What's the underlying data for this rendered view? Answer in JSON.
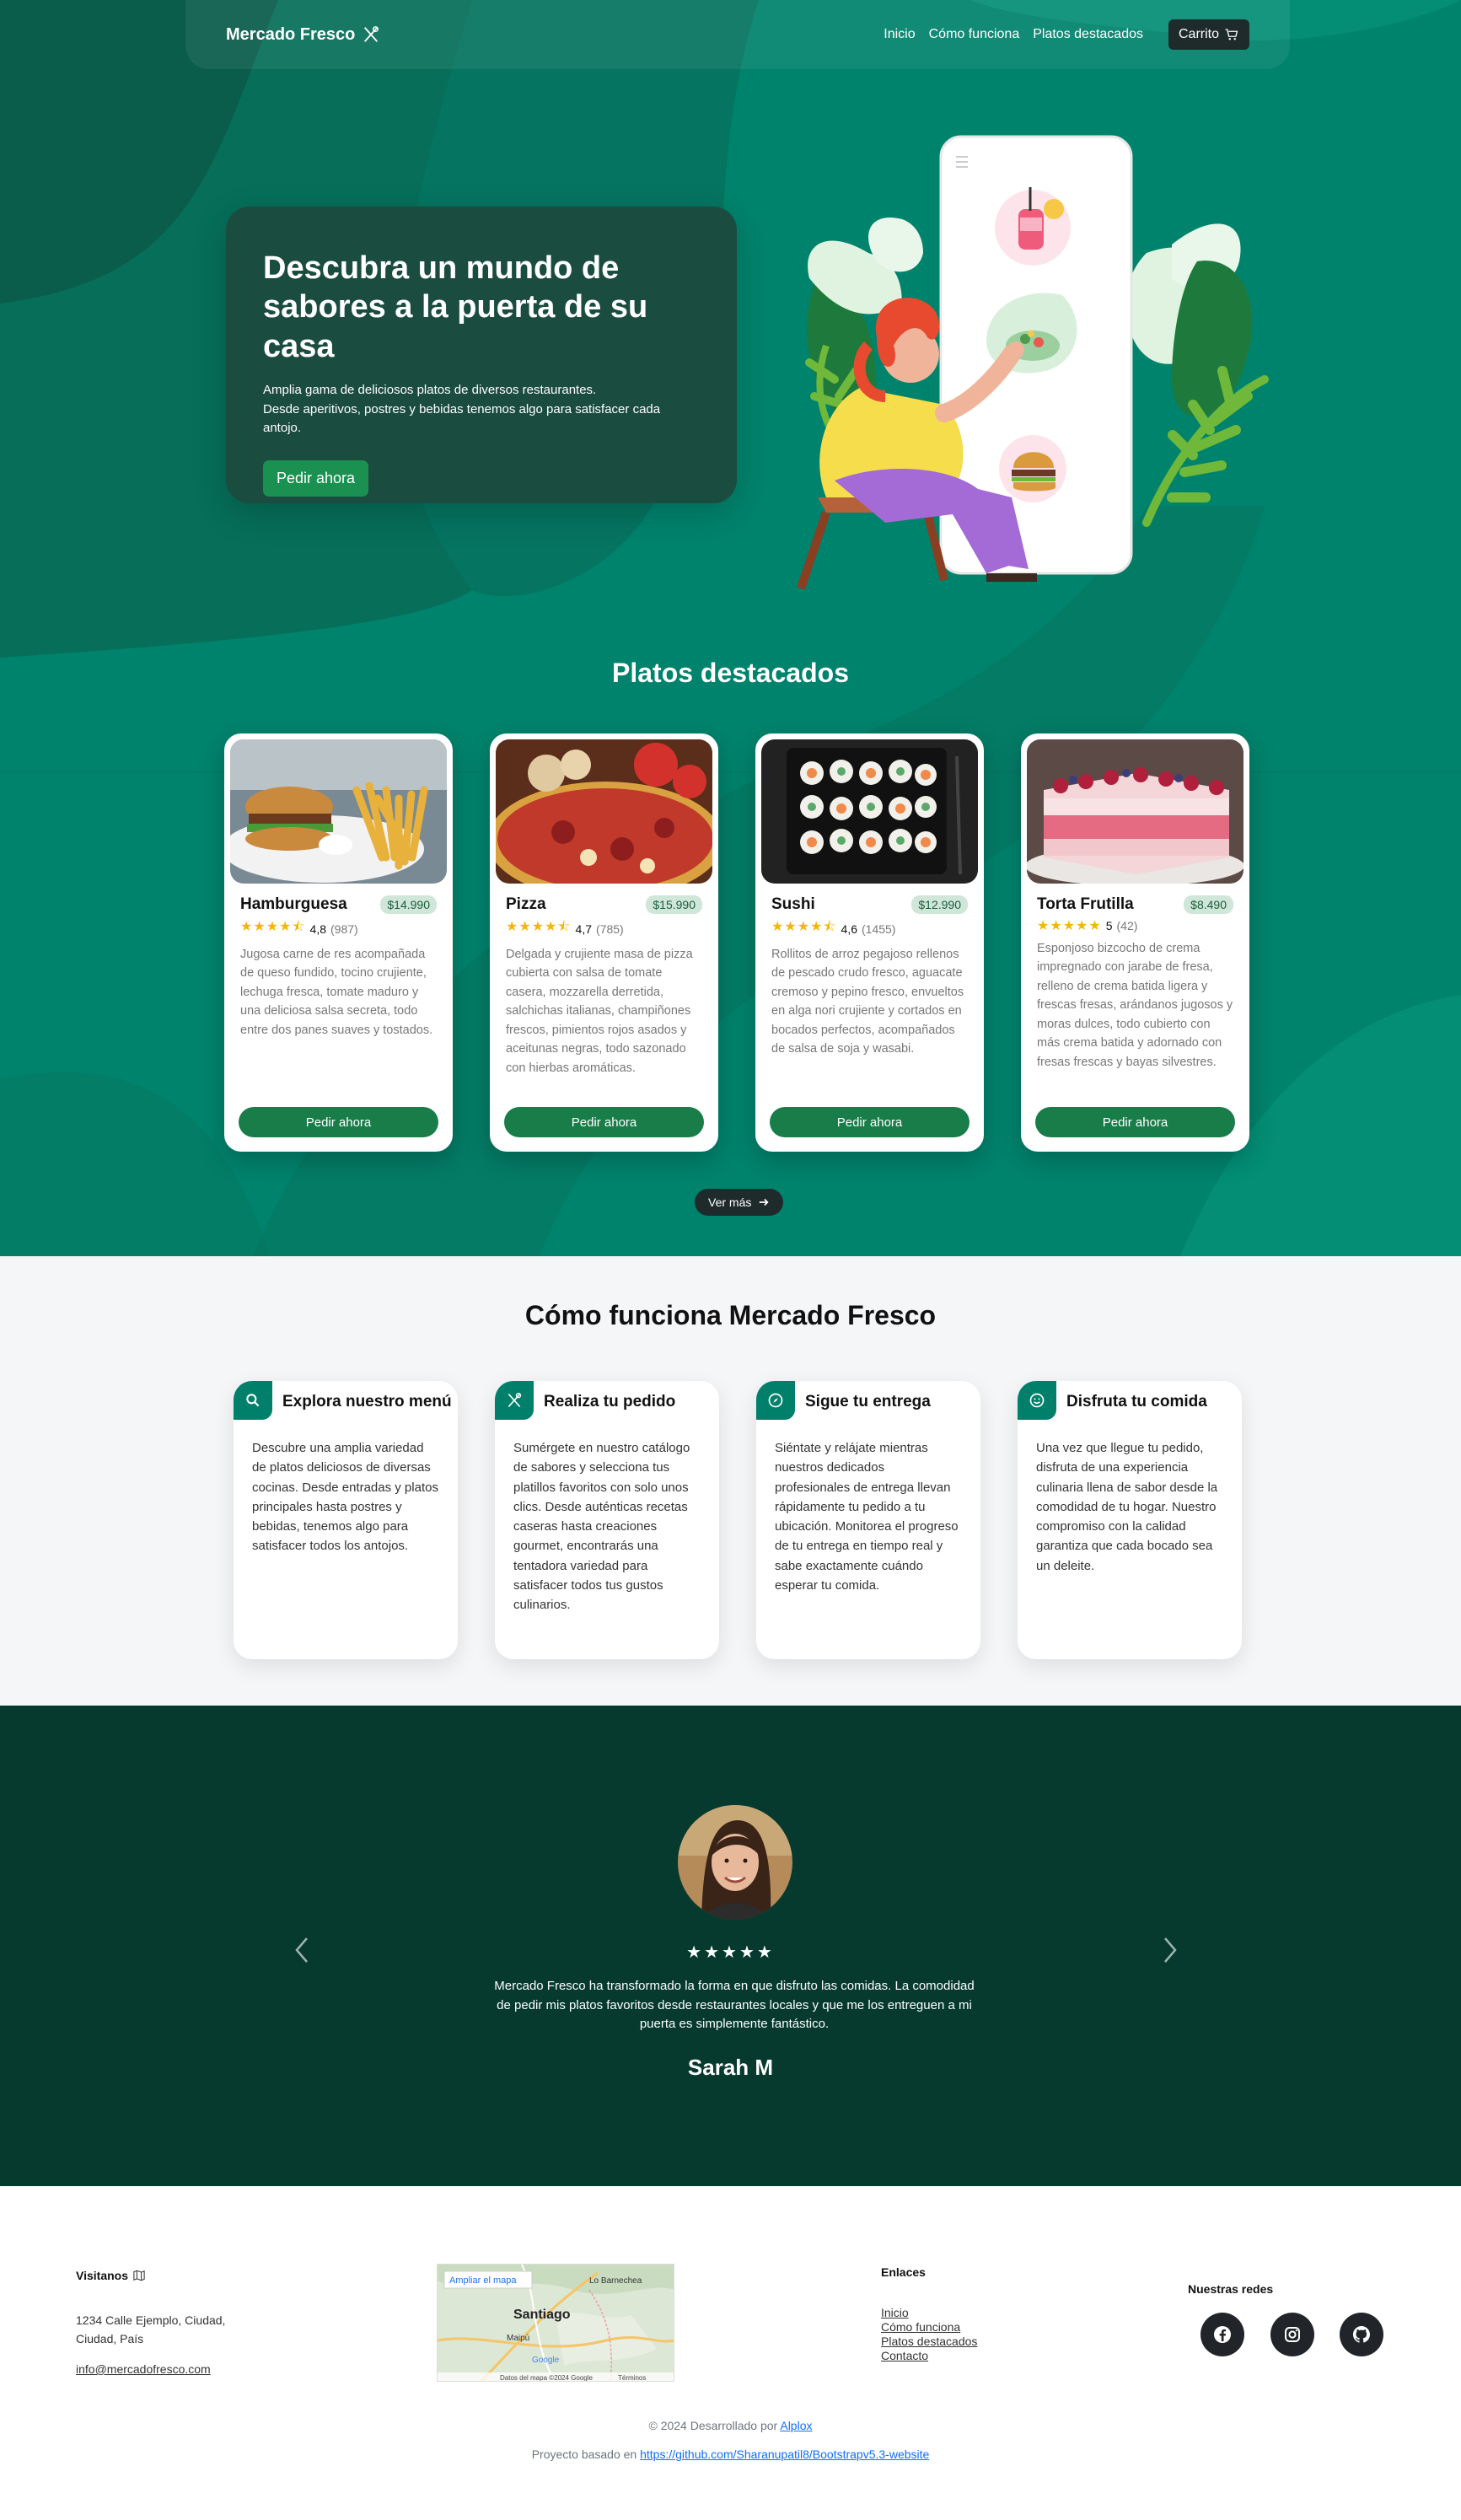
{
  "nav": {
    "brand": "Mercado Fresco",
    "links": [
      "Inicio",
      "Cómo funciona",
      "Platos destacados"
    ],
    "cart_label": "Carrito"
  },
  "hero": {
    "title": "Descubra un mundo de sabores a la puerta de su casa",
    "line1": "Amplia gama de deliciosos platos de diversos restaurantes.",
    "line2": "Desde aperitivos, postres y bebidas tenemos algo para satisfacer cada antojo.",
    "cta": "Pedir ahora"
  },
  "featured": {
    "title": "Platos destacados",
    "dishes": [
      {
        "name": "Hamburguesa",
        "price": "$14.990",
        "stars": "★★★★⯪",
        "rating": "4,8",
        "count": "(987)",
        "desc": "Jugosa carne de res acompañada de queso fundido, tocino crujiente, lechuga fresca, tomate maduro y una deliciosa salsa secreta, todo entre dos panes suaves y tostados.",
        "button": "Pedir ahora"
      },
      {
        "name": "Pizza",
        "price": "$15.990",
        "stars": "★★★★⯪",
        "rating": "4,7",
        "count": "(785)",
        "desc": "Delgada y crujiente masa de pizza cubierta con salsa de tomate casera, mozzarella derretida, salchichas italianas, champiñones frescos, pimientos rojos asados y aceitunas negras, todo sazonado con hierbas aromáticas.",
        "button": "Pedir ahora"
      },
      {
        "name": "Sushi",
        "price": "$12.990",
        "stars": "★★★★⯪",
        "rating": "4,6",
        "count": "(1455)",
        "desc": "Rollitos de arroz pegajoso rellenos de pescado crudo fresco, aguacate cremoso y pepino fresco, envueltos en alga nori crujiente y cortados en bocados perfectos, acompañados de salsa de soja y wasabi.",
        "button": "Pedir ahora"
      },
      {
        "name": "Torta Frutilla",
        "price": "$8.490",
        "stars": "★★★★★",
        "rating": "5",
        "count": "(42)",
        "desc": "Esponjoso bizcocho de crema impregnado con jarabe de fresa, relleno de crema batida ligera y frescas fresas, arándanos jugosos y moras dulces, todo cubierto con más crema batida y adornado con fresas frescas y bayas silvestres.",
        "button": "Pedir ahora"
      }
    ],
    "more": "Ver más"
  },
  "how": {
    "title": "Cómo funciona Mercado Fresco",
    "steps": [
      {
        "icon": "search-icon",
        "title": "Explora nuestro menú",
        "text": "Descubre una amplia variedad de platos deliciosos de diversas cocinas. Desde entradas y platos principales hasta postres y bebidas, tenemos algo para satisfacer todos los antojos."
      },
      {
        "icon": "utensils-icon",
        "title": "Realiza tu pedido",
        "text": "Sumérgete en nuestro catálogo de sabores y selecciona tus platillos favoritos con solo unos clics. Desde auténticas recetas caseras hasta creaciones gourmet, encontrarás una tentadora variedad para satisfacer todos tus gustos culinarios."
      },
      {
        "icon": "compass-icon",
        "title": "Sigue tu entrega",
        "text": "Siéntate y relájate mientras nuestros dedicados profesionales de entrega llevan rápidamente tu pedido a tu ubicación. Monitorea el progreso de tu entrega en tiempo real y sabe exactamente cuándo esperar tu comida."
      },
      {
        "icon": "smile-icon",
        "title": "Disfruta tu comida",
        "text": "Una vez que llegue tu pedido, disfruta de una experiencia culinaria llena de sabor desde la comodidad de tu hogar. Nuestro compromiso con la calidad garantiza que cada bocado sea un deleite."
      }
    ]
  },
  "testimonial": {
    "stars": "★★★★★",
    "quote": "Mercado Fresco ha transformado la forma en que disfruto las comidas. La comodidad de pedir mis platos favoritos desde restaurantes locales y que me los entreguen a mi puerta es simplemente fantástico.",
    "name": "Sarah M"
  },
  "footer": {
    "visit_title": "Visitanos",
    "address": "1234 Calle Ejemplo, Ciudad, Ciudad, País",
    "email": "info@mercadofresco.com",
    "map": {
      "enlarge": "Ampliar el mapa",
      "city": "Santiago",
      "place1": "Lo Barnechea",
      "place2": "Maipú",
      "attribution": "Datos del mapa ©2024 Google",
      "terms": "Términos",
      "logo": "Google"
    },
    "links_title": "Enlaces",
    "links": [
      "Inicio",
      "Cómo funciona",
      "Platos destacados",
      "Contacto"
    ],
    "social_title": "Nuestras redes",
    "copyright_prefix": "© 2024 Desarrollado por",
    "copyright_author": "Alplox",
    "project_prefix": "Proyecto basado en",
    "project_url": "https://github.com/Sharanupatil8/Bootstrapv5.3-website"
  }
}
